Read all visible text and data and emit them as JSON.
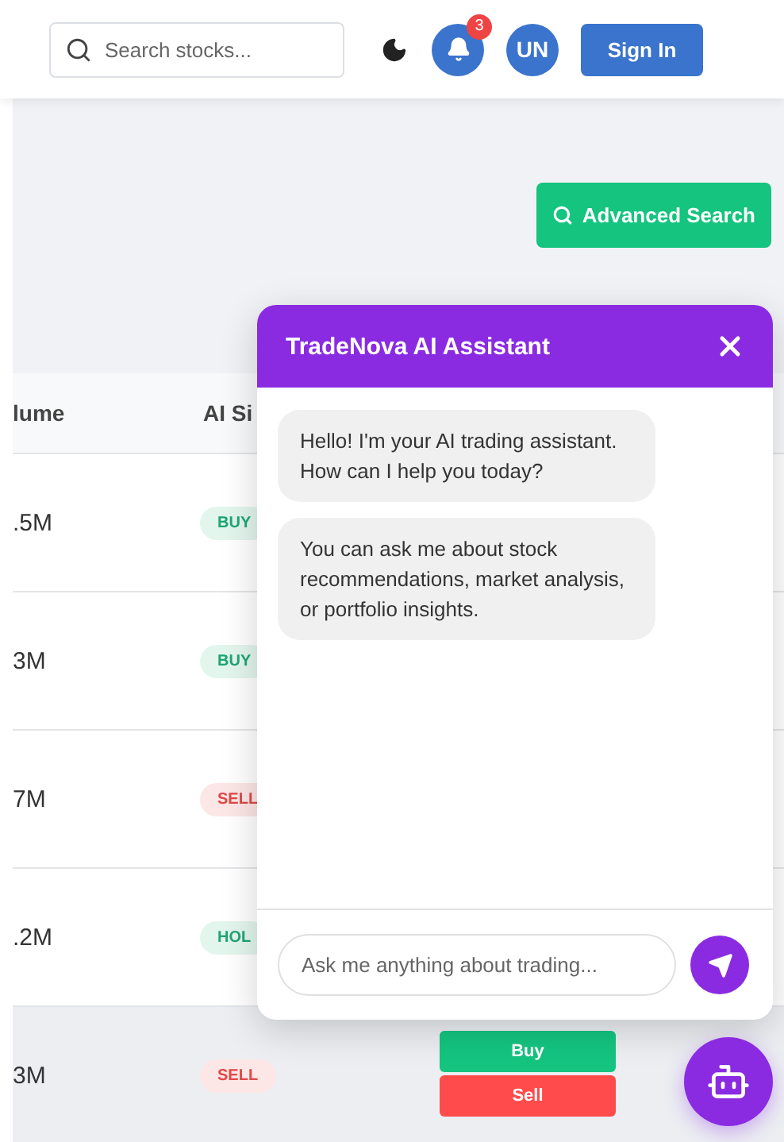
{
  "header": {
    "search": {
      "placeholder": "Search stocks..."
    },
    "notifications": {
      "count": "3"
    },
    "avatar": {
      "initials": "UN"
    },
    "sign_in": "Sign In"
  },
  "advanced_search": "Advanced Search",
  "table": {
    "columns": [
      "lume",
      "AI Si"
    ],
    "rows": [
      {
        "volume": ".5M",
        "signal": {
          "label": "BUY",
          "kind": "buy"
        },
        "highlighted": false
      },
      {
        "volume": "3M",
        "signal": {
          "label": "BUY",
          "kind": "buy"
        },
        "highlighted": false
      },
      {
        "volume": "7M",
        "signal": {
          "label": "SELL",
          "kind": "sell"
        },
        "highlighted": false
      },
      {
        "volume": ".2M",
        "signal": {
          "label": "HOL",
          "kind": "hold"
        },
        "highlighted": false
      },
      {
        "volume": "3M",
        "signal": {
          "label": "SELL",
          "kind": "sell"
        },
        "highlighted": true,
        "actions": [
          {
            "label": "Buy",
            "kind": "buy"
          },
          {
            "label": "Sell",
            "kind": "sell"
          }
        ]
      }
    ]
  },
  "chat": {
    "title": "TradeNova AI Assistant",
    "messages": [
      "Hello! I'm your AI trading assistant. How can I help you today?",
      "You can ask me about stock recommendations, market analysis, or portfolio insights."
    ],
    "input": {
      "placeholder": "Ask me anything about trading..."
    }
  }
}
